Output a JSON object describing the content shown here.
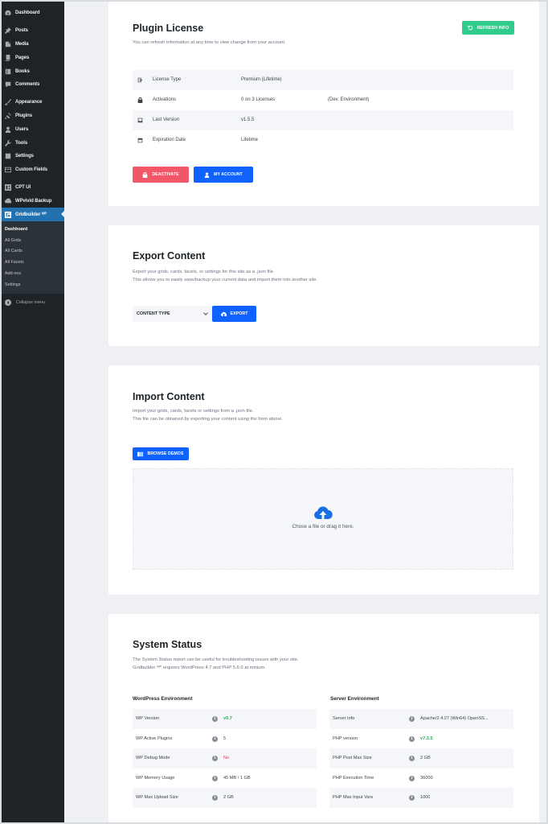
{
  "sidebar": {
    "items": [
      {
        "label": "Dashboard",
        "icon": "dashboard-icon"
      },
      {
        "label": "Posts",
        "icon": "pin-icon"
      },
      {
        "label": "Media",
        "icon": "media-icon"
      },
      {
        "label": "Pages",
        "icon": "pages-icon"
      },
      {
        "label": "Books",
        "icon": "book-icon"
      },
      {
        "label": "Comments",
        "icon": "comment-icon"
      },
      {
        "label": "Appearance",
        "icon": "brush-icon"
      },
      {
        "label": "Plugins",
        "icon": "plugin-icon"
      },
      {
        "label": "Users",
        "icon": "user-icon"
      },
      {
        "label": "Tools",
        "icon": "wrench-icon"
      },
      {
        "label": "Settings",
        "icon": "settings-icon"
      },
      {
        "label": "Custom Fields",
        "icon": "fields-icon"
      },
      {
        "label": "CPT UI",
        "icon": "cptui-icon"
      },
      {
        "label": "WPvivid Backup",
        "icon": "backup-icon"
      },
      {
        "label": "Gridbuilder ᵂᴾ",
        "icon": "gridbuilder-icon"
      }
    ],
    "submenu": [
      "Dashboard",
      "All Grids",
      "All Cards",
      "All Facets",
      "Add-ons",
      "Settings"
    ],
    "collapse_label": "Collapse menu"
  },
  "license": {
    "title": "Plugin License",
    "description": "You can refresh information at any time to view change from your account.",
    "refresh_label": "Refresh Info",
    "rows": [
      {
        "key": "License Type",
        "value": "Premium (Lifetime)",
        "extra": "",
        "icon": "license-icon"
      },
      {
        "key": "Activations",
        "value": "0 on 3 Licenses",
        "extra": "(Dev. Environment)",
        "icon": "lock-icon"
      },
      {
        "key": "Last Version",
        "value": "v1.5.5",
        "extra": "",
        "icon": "inbox-icon"
      },
      {
        "key": "Expiration Date",
        "value": "Lifetime",
        "extra": "",
        "icon": "calendar-icon"
      }
    ],
    "deactivate_label": "Deactivate",
    "account_label": "My Account"
  },
  "export": {
    "title": "Export Content",
    "description_1": "Export your grids, cards, facets, or settings for this site as a .json file.",
    "description_2": "This allows you to easily save/backup your current data and import them into another site.",
    "select_value": "CONTENT TYPE",
    "export_label": "Export"
  },
  "import": {
    "title": "Import Content",
    "description_1": "Import your grids, cards, facets or settings from a .json file.",
    "description_2": "This file can be obtained by exporting your content using the form above.",
    "browse_label": "Browse Demos",
    "drop_text": "Chose a file or drag it here."
  },
  "status": {
    "title": "System Status",
    "description_1": "The System Status report can be useful for troubleshooting issues with your site.",
    "description_2": "Gridbuilder ᵂᴾ requires WordPress 4.7 and PHP 5.6.0 at minium.",
    "wp_heading": "WordPress Environment",
    "server_heading": "Server Environment",
    "wp_rows": [
      {
        "key": "WP Version",
        "value": "v5.7"
      },
      {
        "key": "WP Active Plugins",
        "value": "5"
      },
      {
        "key": "WP Debug Mode",
        "value": "No"
      },
      {
        "key": "WP Memory Usage",
        "value": "45 MB / 1 GB"
      },
      {
        "key": "WP Max Upload Size",
        "value": "2 GB"
      }
    ],
    "server_rows": [
      {
        "key": "Server Info",
        "value": "Apache/2.4.27 (Win64) OpenSS..."
      },
      {
        "key": "PHP version",
        "value": "v7.3.5"
      },
      {
        "key": "PHP Post Max Size",
        "value": "2 GB"
      },
      {
        "key": "PHP Execution Time",
        "value": "36000"
      },
      {
        "key": "PHP Max Input Vars",
        "value": "1000"
      }
    ]
  },
  "colors": {
    "sidebar_bg": "#1d2327",
    "active_menu": "#2271b1",
    "primary_blue": "#0f62fe",
    "deactivate_red": "#f25767",
    "refresh_green": "#2fcc8b",
    "ok_green": "#21b35a",
    "error_red": "#e63757"
  }
}
